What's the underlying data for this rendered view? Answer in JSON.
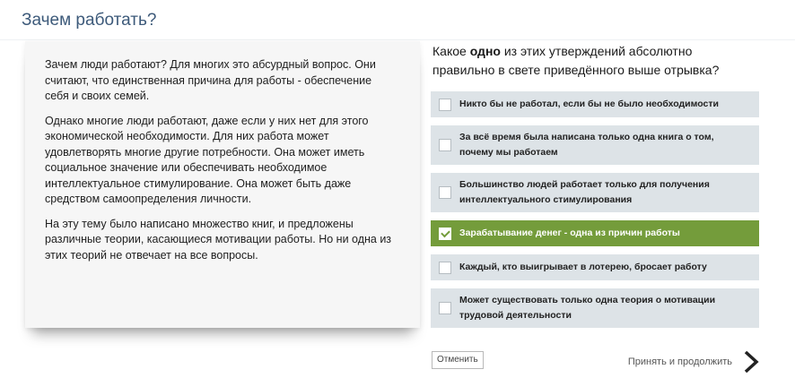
{
  "page": {
    "title": "Зачем работать?"
  },
  "passage": {
    "paragraphs": [
      "Зачем люди работают? Для многих это абсурдный вопрос. Они считают, что единственная причина для работы - обеспечение себя и своих семей.",
      "Однако многие люди работают, даже если у них нет для этого экономической необходимости. Для них работа может удовлетворять многие другие потребности. Она может иметь социальное значение или обеспечивать необходимое интеллектуальное стимулирование. Она может быть даже средством самоопределения личности.",
      "На эту тему было написано множество книг, и предложены различные теории, касающиеся мотивации работы. Но ни одна из этих теорий не отвечает на все вопросы."
    ]
  },
  "question": {
    "prefix": "Какое ",
    "emphasis": "одно",
    "suffix": " из этих утверждений абсолютно правильно в свете приведённого выше отрывка?"
  },
  "options": [
    {
      "label": "Никто бы не работал, если бы не было необходимости",
      "selected": false
    },
    {
      "label": "За всё время была написана только одна книга о том, почему мы работаем",
      "selected": false
    },
    {
      "label": "Большинство людей работает только для получения интеллектуального стимулирования",
      "selected": false
    },
    {
      "label": "Зарабатывание денег - одна из причин работы",
      "selected": true
    },
    {
      "label": "Каждый, кто выигрывает в лотерею, бросает работу",
      "selected": false
    },
    {
      "label": "Может существовать только одна теория о мотивации трудовой деятельности",
      "selected": false
    }
  ],
  "controls": {
    "cancel_label": "Отменить",
    "continue_label": "Принять и продолжить"
  },
  "colors": {
    "title": "#3d5a7a",
    "option_bg": "#dde3e7",
    "option_selected_bg": "#749c3b",
    "passage_bg": "#f6f6f6"
  }
}
